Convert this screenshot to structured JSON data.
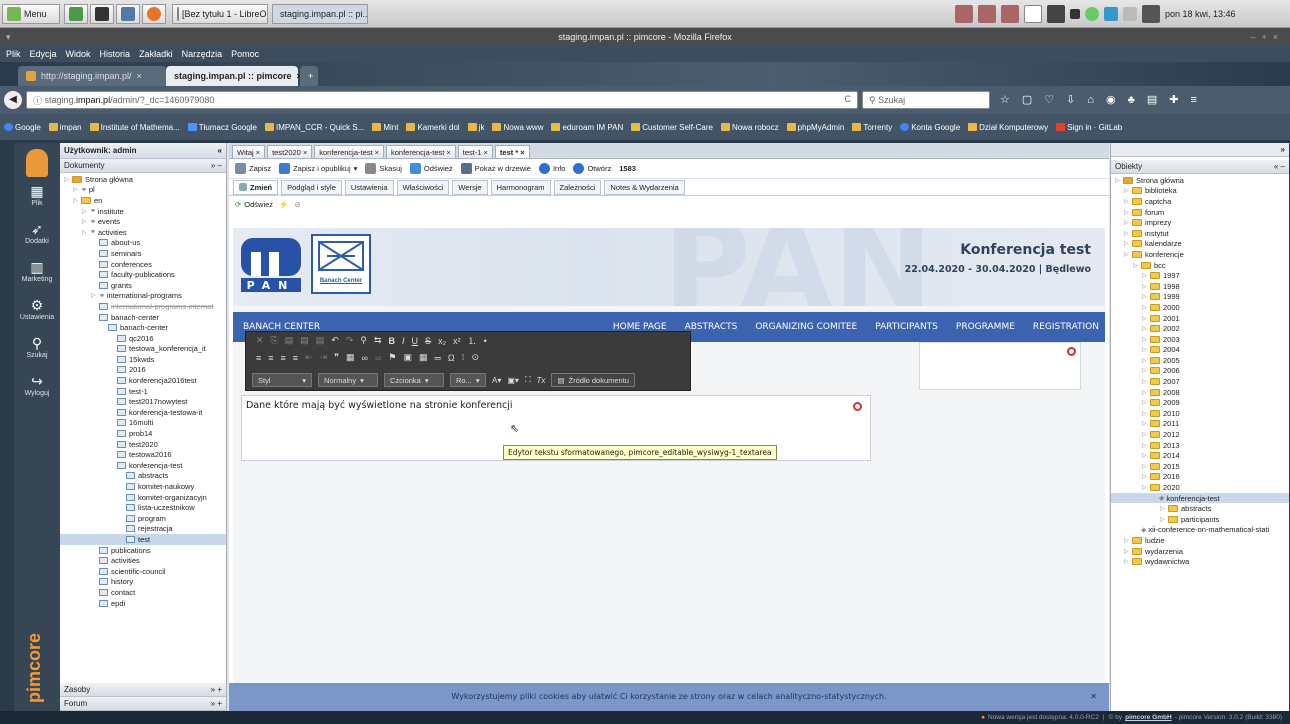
{
  "taskbar": {
    "menu": "Menu",
    "tasks": [
      "[Bez tytułu 1 - LibreO...",
      "staging.impan.pl :: pi..."
    ],
    "clock": "pon 18 kwi, 13:46"
  },
  "browser": {
    "window_title": "staging.impan.pl :: pimcore - Mozilla Firefox",
    "menu": [
      "Plik",
      "Edycja",
      "Widok",
      "Historia",
      "Zakładki",
      "Narzędzia",
      "Pomoc"
    ],
    "tabs": [
      "http://staging.impan.pl/",
      "staging.impan.pl :: pimcore"
    ],
    "url_prefix": "staging.",
    "url_host": "impan.pl",
    "url_path": "/admin/?_dc=1460979080",
    "search_placeholder": "Szukaj",
    "bookmarks": [
      "Google",
      "impan",
      "Institute of Mathema...",
      "Tłumacz Google",
      "IMPAN_CCR - Quick S...",
      "Mint",
      "Kamerki dol",
      "jk",
      "Nowa www",
      "eduroam IM PAN",
      "Customer Self-Care",
      "Nowa robocz",
      "phpMyAdmin",
      "Torrenty",
      "Konta Google",
      "Dział Komputerowy",
      "Sign in · GitLab"
    ]
  },
  "pimcore": {
    "nav": [
      "Plik",
      "Dodatki",
      "Marketing",
      "Ustawienia",
      "Szukaj",
      "Wyloguj"
    ],
    "brand": "pimcore",
    "user": "Użytkownik: admin",
    "docs_header": "Dokumenty",
    "tree": [
      {
        "d": 0,
        "t": "home",
        "label": "Strona główna"
      },
      {
        "d": 1,
        "t": "link",
        "label": "pl"
      },
      {
        "d": 1,
        "t": "folder",
        "label": "en"
      },
      {
        "d": 2,
        "t": "link",
        "label": "institute"
      },
      {
        "d": 2,
        "t": "link",
        "label": "events"
      },
      {
        "d": 2,
        "t": "link",
        "label": "activities"
      },
      {
        "d": 3,
        "t": "page",
        "label": "about-us"
      },
      {
        "d": 3,
        "t": "page",
        "label": "seminars"
      },
      {
        "d": 3,
        "t": "page",
        "label": "conferences"
      },
      {
        "d": 3,
        "t": "page",
        "label": "faculty-publications"
      },
      {
        "d": 3,
        "t": "page",
        "label": "grants"
      },
      {
        "d": 3,
        "t": "link",
        "label": "international-programs"
      },
      {
        "d": 3,
        "t": "page",
        "label": "international-programs-internat",
        "strike": true
      },
      {
        "d": 3,
        "t": "page",
        "label": "banach-center"
      },
      {
        "d": 4,
        "t": "page",
        "label": "banach-center"
      },
      {
        "d": 5,
        "t": "page",
        "label": "qc2016"
      },
      {
        "d": 5,
        "t": "page",
        "label": "testowa_konferencja_it"
      },
      {
        "d": 5,
        "t": "page",
        "label": "15kwds"
      },
      {
        "d": 5,
        "t": "page",
        "label": "2016"
      },
      {
        "d": 5,
        "t": "page",
        "label": "konferencja2016test"
      },
      {
        "d": 5,
        "t": "page",
        "label": "test-1"
      },
      {
        "d": 5,
        "t": "page",
        "label": "test2017nowytest"
      },
      {
        "d": 5,
        "t": "page",
        "label": "konferencja-testowa-it"
      },
      {
        "d": 5,
        "t": "page",
        "label": "16multi"
      },
      {
        "d": 5,
        "t": "page",
        "label": "prob14"
      },
      {
        "d": 5,
        "t": "page",
        "label": "test2020"
      },
      {
        "d": 5,
        "t": "page",
        "label": "testowa2016"
      },
      {
        "d": 5,
        "t": "page",
        "label": "konferencja-test"
      },
      {
        "d": 6,
        "t": "page",
        "label": "abstracts"
      },
      {
        "d": 6,
        "t": "page",
        "label": "komitet-naukowy"
      },
      {
        "d": 6,
        "t": "page",
        "label": "komitet-organizacyjn"
      },
      {
        "d": 6,
        "t": "page",
        "label": "lista-uczestnikow"
      },
      {
        "d": 6,
        "t": "page",
        "label": "program"
      },
      {
        "d": 6,
        "t": "page",
        "label": "rejestracja"
      },
      {
        "d": 6,
        "t": "page",
        "label": "test",
        "selected": true
      },
      {
        "d": 3,
        "t": "page",
        "label": "publications"
      },
      {
        "d": 3,
        "t": "page",
        "label": "activities"
      },
      {
        "d": 3,
        "t": "page",
        "label": "scientific-council"
      },
      {
        "d": 3,
        "t": "page",
        "label": "history"
      },
      {
        "d": 3,
        "t": "page",
        "label": "contact"
      },
      {
        "d": 3,
        "t": "page",
        "label": "epdi"
      }
    ],
    "bottom_panels": [
      "Zasoby",
      "Forum"
    ],
    "editor_tabs": [
      "Witaj",
      "test2020",
      "konferencja-test",
      "konferencja-test",
      "test-1",
      "test *"
    ],
    "toolbar": {
      "save": "Zapisz",
      "save_publish": "Zapisz i opublikuj",
      "discard": "Skasuj",
      "reload": "Odśwież",
      "show_tree": "Pokaż w drzewie",
      "info": "Info",
      "open": "Otwórz",
      "id": "1583"
    },
    "subtabs": [
      "Zmień",
      "Podgląd i style",
      "Ustawienia",
      "Właściwości",
      "Wersje",
      "Harmonogram",
      "Zależności",
      "Notes & Wydarzenia"
    ],
    "refresh": "Odśwież",
    "objects_header": "Obiekty",
    "obj_tree": [
      {
        "d": 0,
        "t": "home",
        "label": "Strona główna"
      },
      {
        "d": 1,
        "t": "folder",
        "label": "biblioteka"
      },
      {
        "d": 1,
        "t": "folder",
        "label": "captcha"
      },
      {
        "d": 1,
        "t": "folder",
        "label": "forum"
      },
      {
        "d": 1,
        "t": "folder",
        "label": "imprezy"
      },
      {
        "d": 1,
        "t": "folder",
        "label": "instytut"
      },
      {
        "d": 1,
        "t": "folder",
        "label": "kalendarze"
      },
      {
        "d": 1,
        "t": "folder",
        "label": "konferencje"
      },
      {
        "d": 2,
        "t": "folder",
        "label": "bcc"
      },
      {
        "d": 3,
        "t": "folder",
        "label": "1997"
      },
      {
        "d": 3,
        "t": "folder",
        "label": "1998"
      },
      {
        "d": 3,
        "t": "folder",
        "label": "1999"
      },
      {
        "d": 3,
        "t": "folder",
        "label": "2000"
      },
      {
        "d": 3,
        "t": "folder",
        "label": "2001"
      },
      {
        "d": 3,
        "t": "folder",
        "label": "2002"
      },
      {
        "d": 3,
        "t": "folder",
        "label": "2003"
      },
      {
        "d": 3,
        "t": "folder",
        "label": "2004"
      },
      {
        "d": 3,
        "t": "folder",
        "label": "2005"
      },
      {
        "d": 3,
        "t": "folder",
        "label": "2006"
      },
      {
        "d": 3,
        "t": "folder",
        "label": "2007"
      },
      {
        "d": 3,
        "t": "folder",
        "label": "2008"
      },
      {
        "d": 3,
        "t": "folder",
        "label": "2009"
      },
      {
        "d": 3,
        "t": "folder",
        "label": "2010"
      },
      {
        "d": 3,
        "t": "folder",
        "label": "2011"
      },
      {
        "d": 3,
        "t": "folder",
        "label": "2012"
      },
      {
        "d": 3,
        "t": "folder",
        "label": "2013"
      },
      {
        "d": 3,
        "t": "folder",
        "label": "2014"
      },
      {
        "d": 3,
        "t": "folder",
        "label": "2015"
      },
      {
        "d": 3,
        "t": "folder",
        "label": "2016"
      },
      {
        "d": 3,
        "t": "folder",
        "label": "2020"
      },
      {
        "d": 4,
        "t": "obj",
        "label": "konferencja-test",
        "selected": true
      },
      {
        "d": 5,
        "t": "folder",
        "label": "abstracts"
      },
      {
        "d": 5,
        "t": "folder",
        "label": "participants"
      },
      {
        "d": 2,
        "t": "obj",
        "label": "xii-conference-on-mathematical-stati"
      },
      {
        "d": 1,
        "t": "folder",
        "label": "ludzie"
      },
      {
        "d": 1,
        "t": "folder",
        "label": "wydarzenia"
      },
      {
        "d": 1,
        "t": "folder",
        "label": "wydawnictwa"
      }
    ],
    "status_update": "Nowa wersja jest dostępna: 4.0.0-RC2",
    "status_by": "© by",
    "status_company": "pimcore GmbH",
    "status_version": "- pimcore Version: 3.0.2 (Build: 3380)"
  },
  "site": {
    "logo_text": "PAN",
    "bc_logo": "Banach Center",
    "title": "Konferencja test",
    "dates": "22.04.2020 - 30.04.2020 | Będlewo",
    "brand": "BANACH CENTER",
    "nav": [
      "HOME PAGE",
      "ABSTRACTS",
      "ORGANIZING COMITEE",
      "PARTICIPANTS",
      "PROGRAMME",
      "REGISTRATION"
    ],
    "editor_text": "Dane które mają być wyświetlone na stronie konferencji",
    "tooltip": "Edytor tekstu sformatowanego, pimcore_editable_wysiwyg-1_textarea",
    "cookie": "Wykorzystujemy pliki cookies aby ułatwić Ci korzystanie ze strony oraz w celach analityczno-statystycznych.",
    "ck_dropdowns": [
      "Styl",
      "Normalny",
      "Czcionka",
      "Ro..."
    ],
    "ck_source": "Źródło dokumentu"
  }
}
